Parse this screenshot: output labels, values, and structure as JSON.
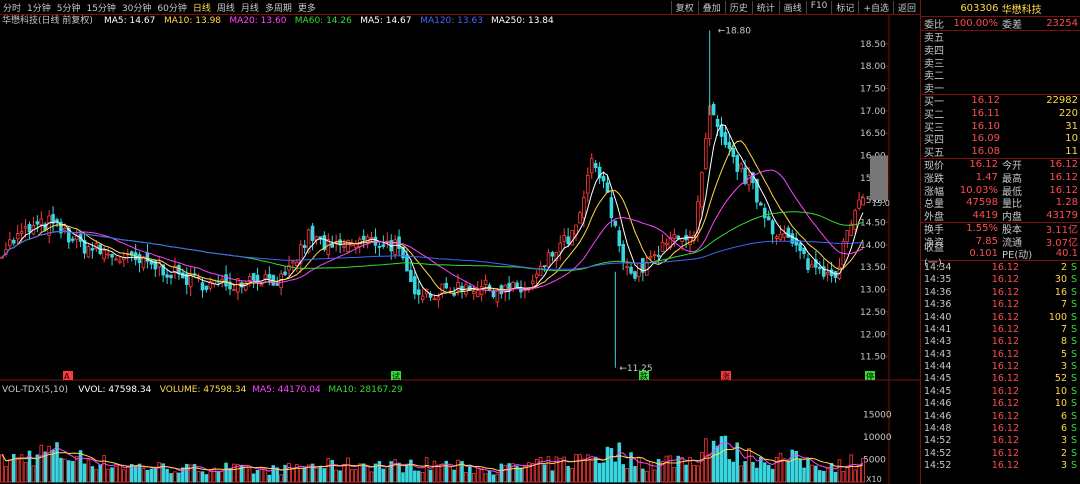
{
  "topbar": {
    "timeframes": [
      {
        "label": "分时",
        "active": false
      },
      {
        "label": "1分钟",
        "active": false
      },
      {
        "label": "5分钟",
        "active": false
      },
      {
        "label": "15分钟",
        "active": false
      },
      {
        "label": "30分钟",
        "active": false
      },
      {
        "label": "60分钟",
        "active": false
      },
      {
        "label": "日线",
        "active": true
      },
      {
        "label": "周线",
        "active": false
      },
      {
        "label": "月线",
        "active": false
      },
      {
        "label": "多周期",
        "active": false
      },
      {
        "label": "更多",
        "active": false
      }
    ],
    "tools": [
      "复权",
      "叠加",
      "历史",
      "统计",
      "画线",
      "F10",
      "标记",
      "+自选",
      "返回"
    ]
  },
  "legend": {
    "title": "华懋科技(日线 前复权)",
    "items": [
      {
        "text": "MA5: 14.67",
        "color": "#ffffff"
      },
      {
        "text": "MA10: 13.98",
        "color": "#ffd94a"
      },
      {
        "text": "MA20: 13.60",
        "color": "#ff44ff"
      },
      {
        "text": "MA60: 14.26",
        "color": "#33dd33"
      },
      {
        "text": "MA5: 14.67",
        "color": "#ffffff"
      },
      {
        "text": "MA120: 13.63",
        "color": "#4466ff"
      },
      {
        "text": "MA250: 13.84",
        "color": "#ffffff"
      }
    ]
  },
  "vol_legend": {
    "items": [
      {
        "text": "VOL-TDX(5,10)",
        "color": "#c8c8c8"
      },
      {
        "text": "VVOL: 47598.34",
        "color": "#ffffff"
      },
      {
        "text": "VOLUME: 47598.34",
        "color": "#ffd94a"
      },
      {
        "text": "MA5: 44170.04",
        "color": "#ff44ff"
      },
      {
        "text": "MA10: 28167.29",
        "color": "#33dd33"
      }
    ]
  },
  "chart_data": {
    "type": "candlestick",
    "price_axis": {
      "range": [
        11.2,
        18.9
      ],
      "ticks": [
        "18.50",
        "18.00",
        "17.50",
        "17.00",
        "16.50",
        "16.00",
        "15.50",
        "15.00",
        "14.50",
        "14.00",
        "13.50",
        "13.00",
        "12.50",
        "12.00",
        "11.50"
      ]
    },
    "volume_axis": {
      "range": [
        0,
        20000
      ],
      "ticks": [
        "15000",
        "10000",
        "5000"
      ],
      "unit": "X10"
    },
    "annotations": [
      {
        "text": "18.80",
        "price": 18.8
      },
      {
        "text": "11.25",
        "price": 11.25
      }
    ],
    "current_price_tag": "15.0",
    "event_markers": [
      "A",
      "试",
      "跌",
      "涨",
      "停"
    ],
    "waypoints": [
      [
        0,
        13.9,
        0.55
      ],
      [
        6,
        14.3,
        0.7
      ],
      [
        12,
        14.5,
        0.85
      ],
      [
        20,
        14.0,
        0.65
      ],
      [
        30,
        13.7,
        0.45
      ],
      [
        40,
        13.5,
        0.4
      ],
      [
        48,
        13.2,
        0.35
      ],
      [
        56,
        13.1,
        0.4
      ],
      [
        64,
        13.3,
        0.3
      ],
      [
        72,
        13.2,
        0.35
      ],
      [
        78,
        14.2,
        0.45
      ],
      [
        84,
        13.9,
        0.45
      ],
      [
        92,
        14.1,
        0.5
      ],
      [
        100,
        14.0,
        0.45
      ],
      [
        104,
        13.1,
        0.45
      ],
      [
        110,
        12.9,
        0.5
      ],
      [
        118,
        13.1,
        0.4
      ],
      [
        126,
        13.0,
        0.35
      ],
      [
        134,
        13.0,
        0.45
      ],
      [
        140,
        13.8,
        0.5
      ],
      [
        146,
        14.3,
        0.6
      ],
      [
        150,
        15.8,
        0.75
      ],
      [
        153,
        15.4,
        0.7
      ],
      [
        156,
        14.3,
        0.85
      ],
      [
        160,
        13.3,
        0.6
      ],
      [
        166,
        13.7,
        0.5
      ],
      [
        172,
        14.3,
        0.65
      ],
      [
        176,
        14.1,
        0.6
      ],
      [
        180,
        17.0,
        1.2
      ],
      [
        183,
        16.3,
        1.0
      ],
      [
        186,
        15.9,
        0.8
      ],
      [
        190,
        15.4,
        0.7
      ],
      [
        196,
        14.4,
        0.6
      ],
      [
        200,
        14.1,
        0.65
      ],
      [
        206,
        13.5,
        0.5
      ],
      [
        212,
        13.4,
        0.45
      ],
      [
        216,
        14.5,
        0.55
      ],
      [
        219,
        15.0,
        0.7
      ]
    ]
  },
  "panel": {
    "code": "603306",
    "name": "华懋科技",
    "weibi": {
      "label": "委比",
      "value": "100.00%",
      "label2": "委差",
      "value2": "23254"
    },
    "asks": [
      {
        "label": "卖五",
        "price": "",
        "vol": ""
      },
      {
        "label": "卖四",
        "price": "",
        "vol": ""
      },
      {
        "label": "卖三",
        "price": "",
        "vol": ""
      },
      {
        "label": "卖二",
        "price": "",
        "vol": ""
      },
      {
        "label": "卖一",
        "price": "",
        "vol": ""
      }
    ],
    "bids": [
      {
        "label": "买一",
        "price": "16.12",
        "vol": "22982"
      },
      {
        "label": "买二",
        "price": "16.11",
        "vol": "220"
      },
      {
        "label": "买三",
        "price": "16.10",
        "vol": "31"
      },
      {
        "label": "买四",
        "price": "16.09",
        "vol": "10"
      },
      {
        "label": "买五",
        "price": "16.08",
        "vol": "11"
      }
    ],
    "quote": [
      {
        "k": "现价",
        "v": "16.12",
        "k2": "今开",
        "v2": "16.12"
      },
      {
        "k": "涨跌",
        "v": "1.47",
        "k2": "最高",
        "v2": "16.12"
      },
      {
        "k": "涨幅",
        "v": "10.03%",
        "k2": "最低",
        "v2": "16.12"
      },
      {
        "k": "总量",
        "v": "47598",
        "k2": "量比",
        "v2": "1.28"
      },
      {
        "k": "外盘",
        "v": "4419",
        "k2": "内盘",
        "v2": "43179"
      }
    ],
    "fund": [
      {
        "k": "换手",
        "v": "1.55%",
        "k2": "股本",
        "v2": "3.11亿"
      },
      {
        "k": "净资",
        "v": "7.85",
        "k2": "流通",
        "v2": "3.07亿"
      },
      {
        "k": "收益(一)",
        "v": "0.101",
        "k2": "PE(动)",
        "v2": "40.1"
      }
    ],
    "ticks": [
      {
        "t": "14:34",
        "p": "16.12",
        "v": "2",
        "d": "S"
      },
      {
        "t": "14:35",
        "p": "16.12",
        "v": "30",
        "d": "S"
      },
      {
        "t": "14:36",
        "p": "16.12",
        "v": "16",
        "d": "S"
      },
      {
        "t": "14:36",
        "p": "16.12",
        "v": "7",
        "d": "S"
      },
      {
        "t": "14:40",
        "p": "16.12",
        "v": "100",
        "d": "S"
      },
      {
        "t": "14:41",
        "p": "16.12",
        "v": "7",
        "d": "S"
      },
      {
        "t": "14:43",
        "p": "16.12",
        "v": "8",
        "d": "S"
      },
      {
        "t": "14:43",
        "p": "16.12",
        "v": "5",
        "d": "S"
      },
      {
        "t": "14:44",
        "p": "16.12",
        "v": "3",
        "d": "S"
      },
      {
        "t": "14:45",
        "p": "16.12",
        "v": "52",
        "d": "S"
      },
      {
        "t": "14:45",
        "p": "16.12",
        "v": "10",
        "d": "S"
      },
      {
        "t": "14:46",
        "p": "16.12",
        "v": "10",
        "d": "S"
      },
      {
        "t": "14:46",
        "p": "16.12",
        "v": "6",
        "d": "S"
      },
      {
        "t": "14:48",
        "p": "16.12",
        "v": "6",
        "d": "S"
      },
      {
        "t": "14:52",
        "p": "16.12",
        "v": "3",
        "d": "S"
      },
      {
        "t": "14:52",
        "p": "16.12",
        "v": "2",
        "d": "S"
      },
      {
        "t": "14:52",
        "p": "16.12",
        "v": "3",
        "d": "S"
      }
    ]
  }
}
